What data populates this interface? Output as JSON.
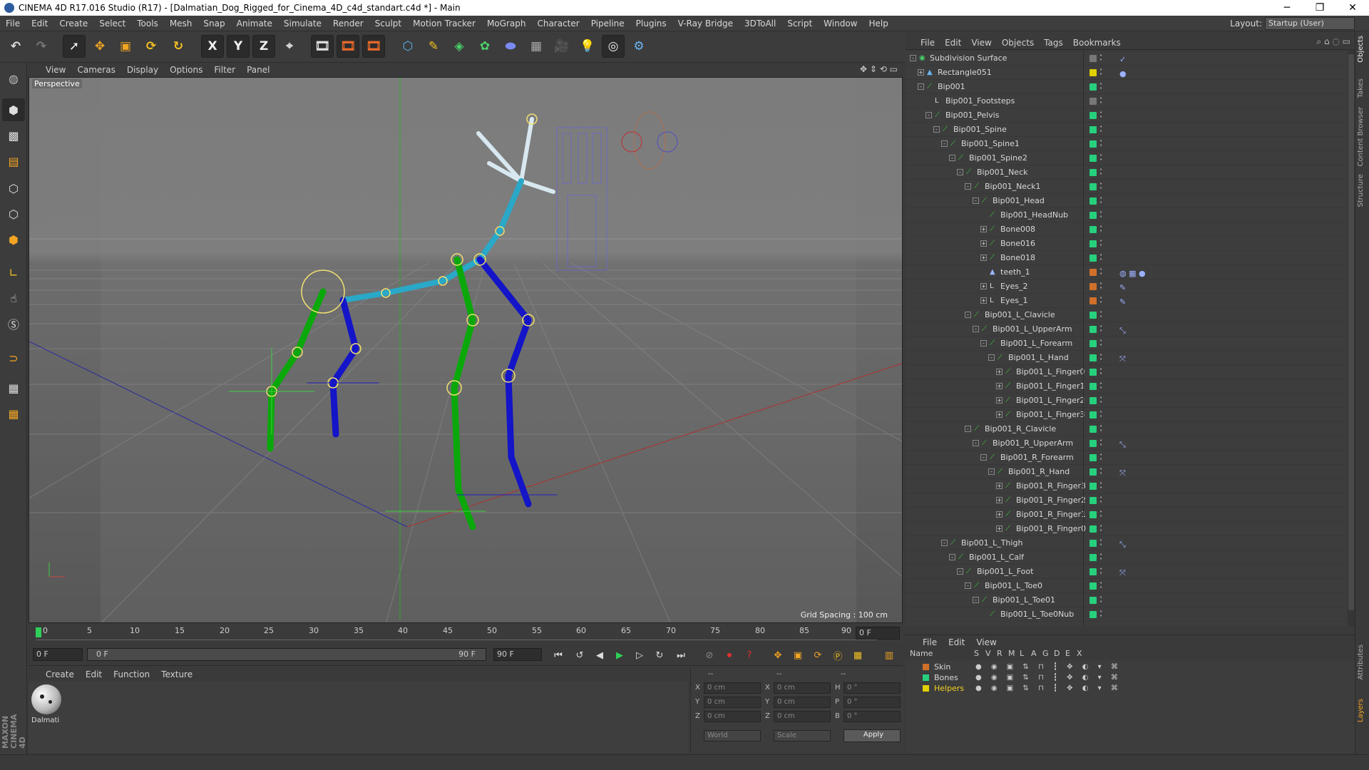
{
  "window": {
    "title": "CINEMA 4D R17.016 Studio (R17) - [Dalmatian_Dog_Rigged_for_Cinema_4D_c4d_standart.c4d *] - Main",
    "minimize": "─",
    "maximize": "❐",
    "close": "✕"
  },
  "menubar": {
    "items": [
      "File",
      "Edit",
      "Create",
      "Select",
      "Tools",
      "Mesh",
      "Snap",
      "Animate",
      "Simulate",
      "Render",
      "Sculpt",
      "Motion Tracker",
      "MoGraph",
      "Character",
      "Pipeline",
      "Plugins",
      "V-Ray Bridge",
      "3DToAll",
      "Script",
      "Window",
      "Help"
    ],
    "layout_label": "Layout:",
    "layout_value": "Startup (User)"
  },
  "toolbar": {
    "x_label": "X",
    "y_label": "Y",
    "z_label": "Z"
  },
  "viewport": {
    "menu": [
      "View",
      "Cameras",
      "Display",
      "Options",
      "Filter",
      "Panel"
    ],
    "camera_label": "Perspective",
    "grid_spacing": "Grid Spacing : 100 cm"
  },
  "timeline": {
    "ticks": [
      "0",
      "5",
      "10",
      "15",
      "20",
      "25",
      "30",
      "35",
      "40",
      "45",
      "50",
      "55",
      "60",
      "65",
      "70",
      "75",
      "80",
      "85",
      "90"
    ],
    "current_frame": "0 F",
    "start_field": "0 F",
    "range_start": "0 F",
    "range_end": "90 F",
    "end_field": "90 F"
  },
  "materials": {
    "menu": [
      "Create",
      "Edit",
      "Function",
      "Texture"
    ],
    "items": [
      {
        "name": "Dalmati"
      }
    ]
  },
  "coordinates": {
    "header": [
      "--",
      "--",
      "--"
    ],
    "rows": [
      {
        "axis": "X",
        "pos": "0 cm",
        "axis2": "X",
        "size": "0 cm",
        "rot_label": "H",
        "rot": "0 °"
      },
      {
        "axis": "Y",
        "pos": "0 cm",
        "axis2": "Y",
        "size": "0 cm",
        "rot_label": "P",
        "rot": "0 °"
      },
      {
        "axis": "Z",
        "pos": "0 cm",
        "axis2": "Z",
        "size": "0 cm",
        "rot_label": "B",
        "rot": "0 °"
      }
    ],
    "mode": "World",
    "transform": "Scale",
    "apply": "Apply"
  },
  "object_manager": {
    "menu": [
      "File",
      "Edit",
      "View",
      "Objects",
      "Tags",
      "Bookmarks"
    ],
    "objects": [
      {
        "name": "Subdivision Surface",
        "depth": 0,
        "color": "#777777",
        "icon": "subdiv",
        "expander": "-",
        "extra": "✓"
      },
      {
        "name": "Rectangle051",
        "depth": 1,
        "color": "#e0d000",
        "icon": "spline",
        "expander": "+",
        "extra": "●"
      },
      {
        "name": "Bip001",
        "depth": 1,
        "color": "#26d07c",
        "icon": "bone",
        "expander": "-",
        "extra": ""
      },
      {
        "name": "Bip001_Footsteps",
        "depth": 2,
        "color": "#777777",
        "icon": "null",
        "expander": "",
        "extra": ""
      },
      {
        "name": "Bip001_Pelvis",
        "depth": 2,
        "color": "#26d07c",
        "icon": "bone",
        "expander": "-",
        "extra": ""
      },
      {
        "name": "Bip001_Spine",
        "depth": 3,
        "color": "#26d07c",
        "icon": "bone",
        "expander": "-",
        "extra": ""
      },
      {
        "name": "Bip001_Spine1",
        "depth": 4,
        "color": "#26d07c",
        "icon": "bone",
        "expander": "-",
        "extra": ""
      },
      {
        "name": "Bip001_Spine2",
        "depth": 5,
        "color": "#26d07c",
        "icon": "bone",
        "expander": "-",
        "extra": ""
      },
      {
        "name": "Bip001_Neck",
        "depth": 6,
        "color": "#26d07c",
        "icon": "bone",
        "expander": "-",
        "extra": ""
      },
      {
        "name": "Bip001_Neck1",
        "depth": 7,
        "color": "#26d07c",
        "icon": "bone",
        "expander": "-",
        "extra": ""
      },
      {
        "name": "Bip001_Head",
        "depth": 8,
        "color": "#26d07c",
        "icon": "bone",
        "expander": "-",
        "extra": ""
      },
      {
        "name": "Bip001_HeadNub",
        "depth": 9,
        "color": "#26d07c",
        "icon": "bone",
        "expander": "",
        "extra": ""
      },
      {
        "name": "Bone008",
        "depth": 9,
        "color": "#26d07c",
        "icon": "bone",
        "expander": "+",
        "extra": ""
      },
      {
        "name": "Bone016",
        "depth": 9,
        "color": "#26d07c",
        "icon": "bone",
        "expander": "+",
        "extra": ""
      },
      {
        "name": "Bone018",
        "depth": 9,
        "color": "#26d07c",
        "icon": "bone",
        "expander": "+",
        "extra": ""
      },
      {
        "name": "teeth_1",
        "depth": 9,
        "color": "#d0702a",
        "icon": "poly",
        "expander": "",
        "extra": "◍ ▦ ●"
      },
      {
        "name": "Eyes_2",
        "depth": 9,
        "color": "#d0702a",
        "icon": "null",
        "expander": "+",
        "extra": "✎"
      },
      {
        "name": "Eyes_1",
        "depth": 9,
        "color": "#d0702a",
        "icon": "null",
        "expander": "+",
        "extra": "✎"
      },
      {
        "name": "Bip001_L_Clavicle",
        "depth": 7,
        "color": "#26d07c",
        "icon": "bone",
        "expander": "-",
        "extra": ""
      },
      {
        "name": "Bip001_L_UpperArm",
        "depth": 8,
        "color": "#26d07c",
        "icon": "bone",
        "expander": "-",
        "extra": "⤡"
      },
      {
        "name": "Bip001_L_Forearm",
        "depth": 9,
        "color": "#26d07c",
        "icon": "bone",
        "expander": "-",
        "extra": ""
      },
      {
        "name": "Bip001_L_Hand",
        "depth": 10,
        "color": "#26d07c",
        "icon": "bone",
        "expander": "-",
        "extra": "⤧"
      },
      {
        "name": "Bip001_L_Finger0",
        "depth": 11,
        "color": "#26d07c",
        "icon": "bone",
        "expander": "+",
        "extra": ""
      },
      {
        "name": "Bip001_L_Finger1",
        "depth": 11,
        "color": "#26d07c",
        "icon": "bone",
        "expander": "+",
        "extra": ""
      },
      {
        "name": "Bip001_L_Finger2",
        "depth": 11,
        "color": "#26d07c",
        "icon": "bone",
        "expander": "+",
        "extra": ""
      },
      {
        "name": "Bip001_L_Finger3",
        "depth": 11,
        "color": "#26d07c",
        "icon": "bone",
        "expander": "+",
        "extra": ""
      },
      {
        "name": "Bip001_R_Clavicle",
        "depth": 7,
        "color": "#26d07c",
        "icon": "bone",
        "expander": "-",
        "extra": ""
      },
      {
        "name": "Bip001_R_UpperArm",
        "depth": 8,
        "color": "#26d07c",
        "icon": "bone",
        "expander": "-",
        "extra": "⤡"
      },
      {
        "name": "Bip001_R_Forearm",
        "depth": 9,
        "color": "#26d07c",
        "icon": "bone",
        "expander": "-",
        "extra": ""
      },
      {
        "name": "Bip001_R_Hand",
        "depth": 10,
        "color": "#26d07c",
        "icon": "bone",
        "expander": "-",
        "extra": "⤧"
      },
      {
        "name": "Bip001_R_Finger3",
        "depth": 11,
        "color": "#26d07c",
        "icon": "bone",
        "expander": "+",
        "extra": ""
      },
      {
        "name": "Bip001_R_Finger2",
        "depth": 11,
        "color": "#26d07c",
        "icon": "bone",
        "expander": "+",
        "extra": ""
      },
      {
        "name": "Bip001_R_Finger1",
        "depth": 11,
        "color": "#26d07c",
        "icon": "bone",
        "expander": "+",
        "extra": ""
      },
      {
        "name": "Bip001_R_Finger0",
        "depth": 11,
        "color": "#26d07c",
        "icon": "bone",
        "expander": "+",
        "extra": ""
      },
      {
        "name": "Bip001_L_Thigh",
        "depth": 4,
        "color": "#26d07c",
        "icon": "bone",
        "expander": "-",
        "extra": "⤡"
      },
      {
        "name": "Bip001_L_Calf",
        "depth": 5,
        "color": "#26d07c",
        "icon": "bone",
        "expander": "-",
        "extra": ""
      },
      {
        "name": "Bip001_L_Foot",
        "depth": 6,
        "color": "#26d07c",
        "icon": "bone",
        "expander": "-",
        "extra": "⤧"
      },
      {
        "name": "Bip001_L_Toe0",
        "depth": 7,
        "color": "#26d07c",
        "icon": "bone",
        "expander": "-",
        "extra": ""
      },
      {
        "name": "Bip001_L_Toe01",
        "depth": 8,
        "color": "#26d07c",
        "icon": "bone",
        "expander": "-",
        "extra": ""
      },
      {
        "name": "Bip001_L_Toe0Nub",
        "depth": 9,
        "color": "#26d07c",
        "icon": "bone",
        "expander": "",
        "extra": ""
      }
    ]
  },
  "layers": {
    "menu": [
      "File",
      "Edit",
      "View"
    ],
    "columns": [
      "Name",
      "S",
      "V",
      "R",
      "M",
      "L",
      "A",
      "G",
      "D",
      "E",
      "X"
    ],
    "items": [
      {
        "name": "Skin",
        "color": "#d0702a",
        "text_color": "#d8d8d8"
      },
      {
        "name": "Bones",
        "color": "#26d07c",
        "text_color": "#d8d8d8"
      },
      {
        "name": "Helpers",
        "color": "#e0d000",
        "text_color": "#f0d020"
      }
    ]
  },
  "right_tabs": [
    "Objects",
    "Takes",
    "Content Browser",
    "Structure",
    "Attributes",
    "Layers"
  ],
  "brand": "MAXON CINEMA 4D"
}
